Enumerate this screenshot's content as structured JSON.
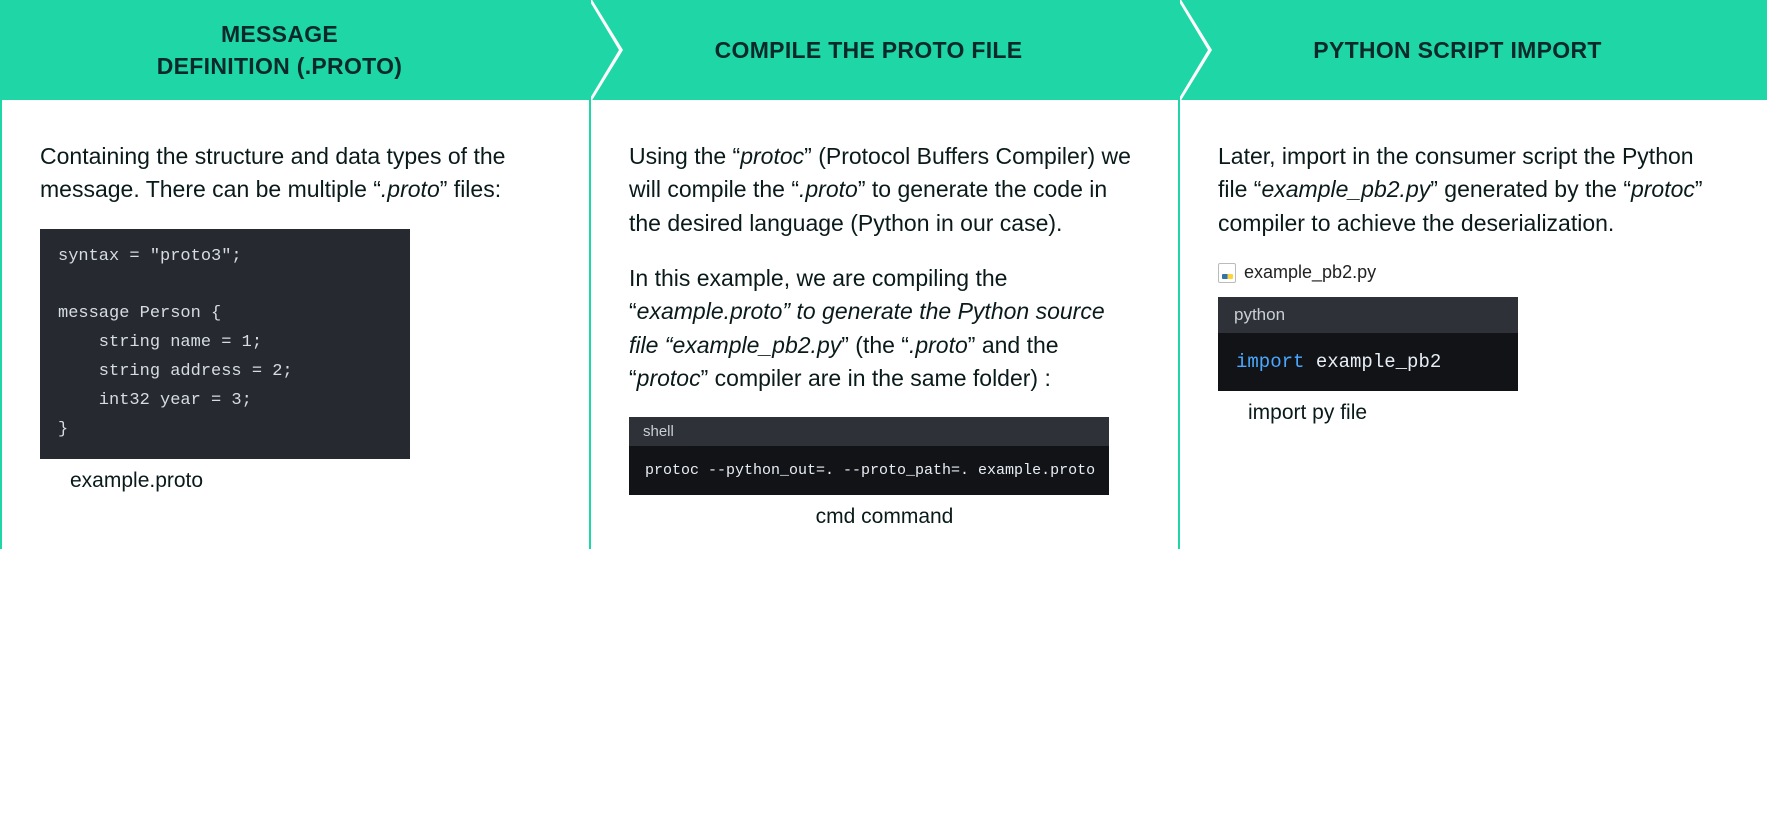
{
  "steps": [
    {
      "title": "MESSAGE\nDEFINITION (.PROTO)"
    },
    {
      "title": "COMPILE THE PROTO FILE"
    },
    {
      "title": "PYTHON SCRIPT IMPORT"
    }
  ],
  "col1": {
    "desc_pre": "Containing the structure and data types of the message. There can be multiple “",
    "desc_em": ".proto",
    "desc_post": "” files:",
    "code": "syntax = \"proto3\";\n\nmessage Person {\n    string name = 1;\n    string address = 2;\n    int32 year = 3;\n}",
    "caption": "example.proto"
  },
  "col2": {
    "p1_pre": "Using the “",
    "p1_em1": "protoc",
    "p1_mid1": "” (Protocol Buffers Compiler) we will compile the “",
    "p1_em2": ".proto",
    "p1_post": "” to generate the code in the desired language (Python in our case).",
    "p2_pre": "In this example, we are compiling the “",
    "p2_em1": "example.proto” to generate the Python source file “example_pb2.py",
    "p2_mid": "” (the “",
    "p2_em2": ".proto",
    "p2_mid2": "” and the “",
    "p2_em3": "protoc",
    "p2_post": "” compiler are in the same folder) :",
    "shell_lang": "shell",
    "shell_code": "protoc --python_out=. --proto_path=. example.proto",
    "caption": "cmd command"
  },
  "col3": {
    "p_pre": "Later, import in the consumer script the Python file “",
    "p_em1": "example_pb2.py",
    "p_mid": "” generated by the “",
    "p_em2": "protoc",
    "p_post": "” compiler to achieve the deserialization.",
    "file_name": "example_pb2.py",
    "py_lang": "python",
    "py_kw": "import",
    "py_rest": " example_pb2",
    "caption": "import py file"
  }
}
